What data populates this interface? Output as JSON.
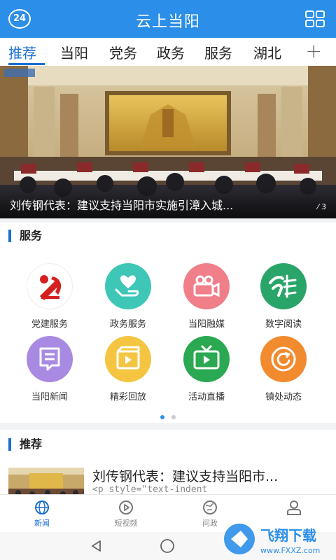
{
  "header": {
    "badge": "24",
    "title": "云上当阳"
  },
  "tabs": [
    "推荐",
    "当阳",
    "党务",
    "政务",
    "服务",
    "湖北"
  ],
  "hero": {
    "caption": "刘传钢代表：建议支持当阳市实施引漳入城...",
    "counter": "3"
  },
  "services": {
    "heading": "服务",
    "items": [
      {
        "label": "党建服务",
        "icon": "party-emblem-icon",
        "color": "#ffffff"
      },
      {
        "label": "政务服务",
        "icon": "heart-hand-icon",
        "color": "#3ec6b6"
      },
      {
        "label": "当阳融媒",
        "icon": "video-camera-icon",
        "color": "#f07f8a"
      },
      {
        "label": "数字阅读",
        "icon": "reading-logo-icon",
        "color": "#2aa56a"
      },
      {
        "label": "当阳新闻",
        "icon": "news-doc-icon",
        "color": "#a98ae3"
      },
      {
        "label": "精彩回放",
        "icon": "replay-film-icon",
        "color": "#f5c542"
      },
      {
        "label": "活动直播",
        "icon": "tv-live-icon",
        "color": "#2aa852"
      },
      {
        "label": "镇处动态",
        "icon": "refresh-circle-icon",
        "color": "#f28a2e"
      }
    ]
  },
  "recommend": {
    "heading": "推荐",
    "title": "刘传钢代表：建议支持当阳市...",
    "sub": "<p style=\"text-indent"
  },
  "bottom_nav": [
    {
      "label": "新闻",
      "icon": "globe-icon"
    },
    {
      "label": "短视频",
      "icon": "play-circle-icon"
    },
    {
      "label": "问政",
      "icon": "earth-icon"
    },
    {
      "label": "",
      "icon": "user-icon"
    }
  ],
  "watermark": {
    "brand": "飞翔下载",
    "url": "www.FXXZ.com"
  },
  "colors": {
    "accent": "#2b8ee8",
    "tab_active": "#1a6fd1"
  }
}
